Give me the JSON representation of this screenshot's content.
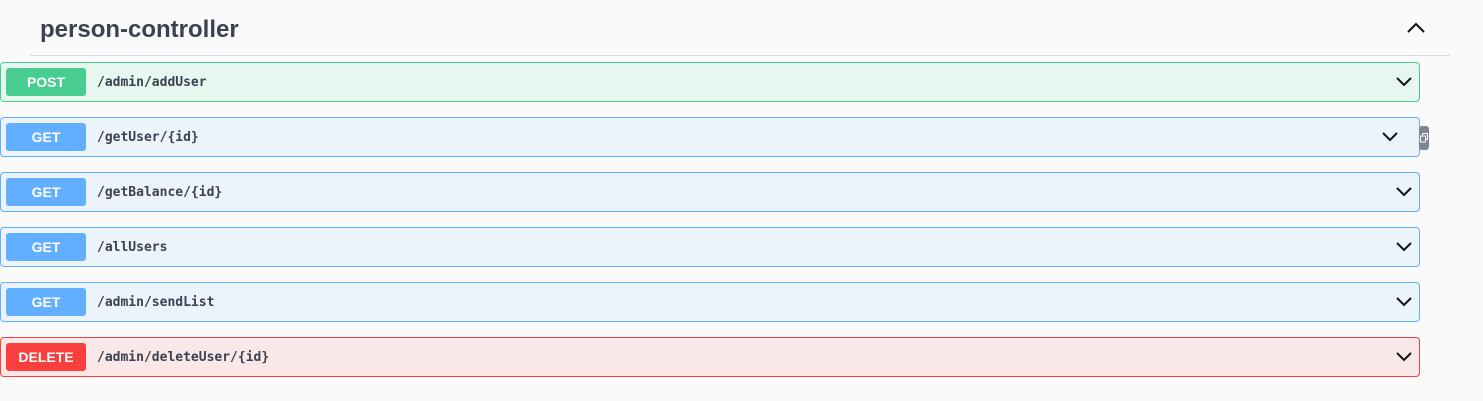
{
  "tag": {
    "title": "person-controller",
    "toggle_icon": "chevron-up-icon"
  },
  "operations": [
    {
      "method": "POST",
      "path": "/admin/addUser",
      "color": "#49cc90"
    },
    {
      "method": "GET",
      "path": "/getUser/{id}",
      "color": "#61affe",
      "copy_icon": "copy-icon"
    },
    {
      "method": "GET",
      "path": "/getBalance/{id}",
      "color": "#61affe"
    },
    {
      "method": "GET",
      "path": "/allUsers",
      "color": "#61affe"
    },
    {
      "method": "GET",
      "path": "/admin/sendList",
      "color": "#61affe"
    },
    {
      "method": "DELETE",
      "path": "/admin/deleteUser/{id}",
      "color": "#f93e3e"
    }
  ],
  "icons": {
    "expand": "chevron-down-icon"
  }
}
